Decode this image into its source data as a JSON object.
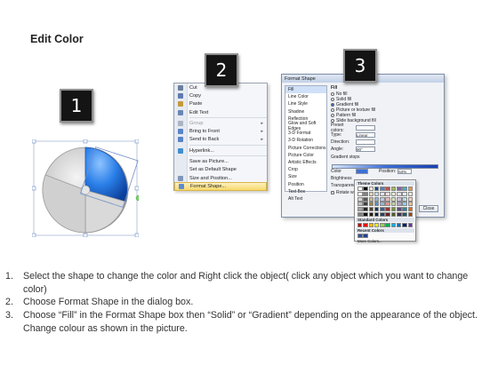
{
  "title": "Edit Color",
  "badges": [
    "1",
    "2",
    "3"
  ],
  "context_menu": {
    "items": [
      {
        "label": "Cut",
        "icon": "scissors-icon",
        "color": "#6a7f9c"
      },
      {
        "label": "Copy",
        "icon": "copy-icon",
        "color": "#5f7ab0"
      },
      {
        "label": "Paste",
        "icon": "clipboard-icon",
        "color": "#c59a3c"
      },
      {
        "label": "Edit Text",
        "icon": "text-edit-icon",
        "color": "#6a86b4"
      },
      {
        "label": "Group",
        "icon": "group-icon",
        "color": "#aab4c4",
        "disabled": true,
        "submenu": true
      },
      {
        "label": "Bring to Front",
        "icon": "bring-front-icon",
        "color": "#5b83c7",
        "submenu": true
      },
      {
        "label": "Send to Back",
        "icon": "send-back-icon",
        "color": "#5b83c7",
        "submenu": true
      },
      {
        "label": "Hyperlink...",
        "icon": "globe-link-icon",
        "color": "#3f8fd0"
      },
      {
        "label": "Save as Picture...",
        "icon": "none",
        "color": "transparent"
      },
      {
        "label": "Set as Default Shape",
        "icon": "none",
        "color": "transparent"
      },
      {
        "label": "Size and Position...",
        "icon": "size-position-icon",
        "color": "#7f95bb"
      },
      {
        "label": "Format Shape...",
        "icon": "format-shape-icon",
        "color": "#5d8bd0",
        "selected": true
      }
    ]
  },
  "dialog": {
    "title": "Format Shape",
    "categories": [
      "Fill",
      "Line Color",
      "Line Style",
      "Shadow",
      "Reflection",
      "Glow and Soft Edges",
      "3-D Format",
      "3-D Rotation",
      "Picture Corrections",
      "Picture Color",
      "Artistic Effects",
      "Crop",
      "Size",
      "Position",
      "Text Box",
      "Alt Text"
    ],
    "active_category": "Fill",
    "panel_heading": "Fill",
    "fill_options": [
      "No fill",
      "Solid fill",
      "Gradient fill",
      "Picture or texture fill",
      "Pattern fill",
      "Slide background fill"
    ],
    "selected_fill": "Gradient fill",
    "fields": [
      {
        "label": "Preset colors:",
        "value": ""
      },
      {
        "label": "Type:",
        "value": "Linear"
      },
      {
        "label": "Direction:",
        "value": ""
      },
      {
        "label": "Angle:",
        "value": "90°"
      }
    ],
    "gradient_stops_label": "Gradient stops",
    "color_label": "Color",
    "position_label": "Position:",
    "position_value": "64%",
    "brightness_label": "Brightness",
    "transparency_label": "Transparency",
    "rotate_label": "Rotate with shape",
    "close_label": "Close"
  },
  "palette": {
    "theme_label": "Theme Colors",
    "standard_label": "Standard Colors",
    "recent_label": "Recent Colors",
    "more_label": "More Colors...",
    "theme_top": [
      "#ffffff",
      "#000000",
      "#eeece1",
      "#1f497d",
      "#4f81bd",
      "#c0504d",
      "#9bbb59",
      "#8064a2",
      "#4bacc6",
      "#f79646"
    ],
    "theme_shades": [
      [
        "#f2f2f2",
        "#7f7f7f",
        "#ddd9c3",
        "#c6d9f0",
        "#dbe5f1",
        "#f2dcdb",
        "#ebf1dd",
        "#e5e0ec",
        "#dbeef3",
        "#fdeada"
      ],
      [
        "#d8d8d8",
        "#595959",
        "#c4bd97",
        "#8db3e2",
        "#b8cce4",
        "#e5b9b7",
        "#d7e3bc",
        "#ccc1d9",
        "#b7dde8",
        "#fbd5b5"
      ],
      [
        "#bfbfbf",
        "#3f3f3f",
        "#938953",
        "#548dd4",
        "#95b3d7",
        "#d99694",
        "#c3d69b",
        "#b2a2c7",
        "#92cddc",
        "#fac08f"
      ],
      [
        "#a5a5a5",
        "#262626",
        "#494429",
        "#17365d",
        "#366092",
        "#953734",
        "#76923c",
        "#5f497a",
        "#31859b",
        "#e36c09"
      ],
      [
        "#7f7f7f",
        "#0c0c0c",
        "#1d1b10",
        "#0f243e",
        "#244061",
        "#632423",
        "#4f6128",
        "#3f3151",
        "#205867",
        "#974806"
      ]
    ],
    "standard": [
      "#c00000",
      "#ff0000",
      "#ffc000",
      "#ffff00",
      "#92d050",
      "#00b050",
      "#00b0f0",
      "#0070c0",
      "#002060",
      "#7030a0"
    ],
    "recent": [
      "#2f5597",
      "#1f3f8f"
    ]
  },
  "instructions": [
    {
      "num": "1.",
      "text": "Select the shape to change the color and Right click the object( click any object which you want to change color)"
    },
    {
      "num": "2.",
      "text": "Choose Format Shape in the dialog box."
    },
    {
      "num": "3.",
      "text": "Choose “Fill” in the Format Shape box then “Solid” or “Gradient” depending on the appearance of the object. Change colour as shown in the picture."
    }
  ]
}
